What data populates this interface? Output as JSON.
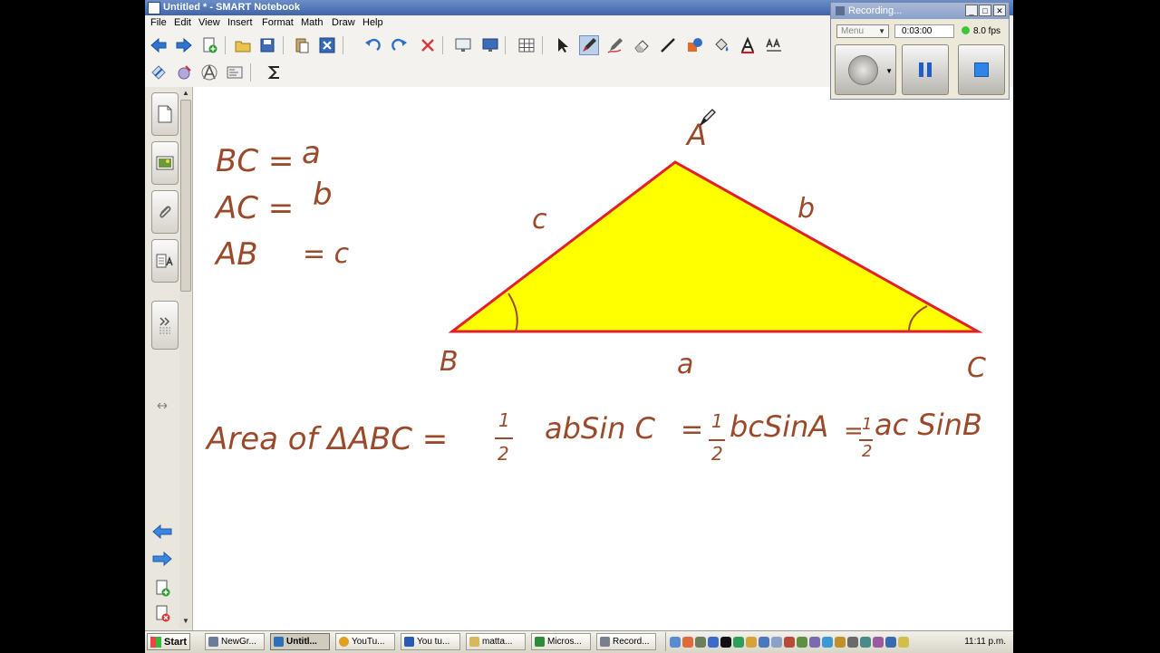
{
  "window": {
    "title": "Untitled * - SMART Notebook"
  },
  "menu": [
    "File",
    "Edit",
    "View",
    "Insert",
    "Format",
    "Math",
    "Draw",
    "Help"
  ],
  "recorder": {
    "title": "Recording...",
    "menu_label": "Menu",
    "elapsed": "0:03:00",
    "fps": "8.0 fps"
  },
  "board": {
    "left_lines": [
      {
        "lhs": "BC =",
        "rhs": "a"
      },
      {
        "lhs": "AC =",
        "rhs": "b"
      },
      {
        "lhs": "AB",
        "rhs": "= c"
      }
    ],
    "vertices": {
      "a": "A",
      "b": "B",
      "c": "C"
    },
    "sides": {
      "ab": "c",
      "ac": "b",
      "bc": "a"
    },
    "formula": {
      "lead": "Area of ΔABC =",
      "t1": "abSin C",
      "eq2": "=",
      "t2": "bcSinA",
      "eq3": "=",
      "t3": "ac SinB",
      "num": "1",
      "den": "2"
    },
    "colors": {
      "ink": "#9a4a2a",
      "fill": "#ffff00",
      "edge": "#e0202a"
    }
  },
  "taskbar": {
    "start": "Start",
    "tasks": [
      {
        "label": "NewGr...",
        "color": "#6a7c9a"
      },
      {
        "label": "Untitl...",
        "color": "#2f6fb8",
        "active": true
      },
      {
        "label": "YouTu...",
        "color": "#e0a020"
      },
      {
        "label": "You tu...",
        "color": "#2a5bb0"
      },
      {
        "label": "matta...",
        "color": "#d8b85a"
      },
      {
        "label": "Micros...",
        "color": "#2e8b3a"
      },
      {
        "label": "Record...",
        "color": "#7a7f8e"
      }
    ],
    "clock": "11:11 p.m."
  }
}
